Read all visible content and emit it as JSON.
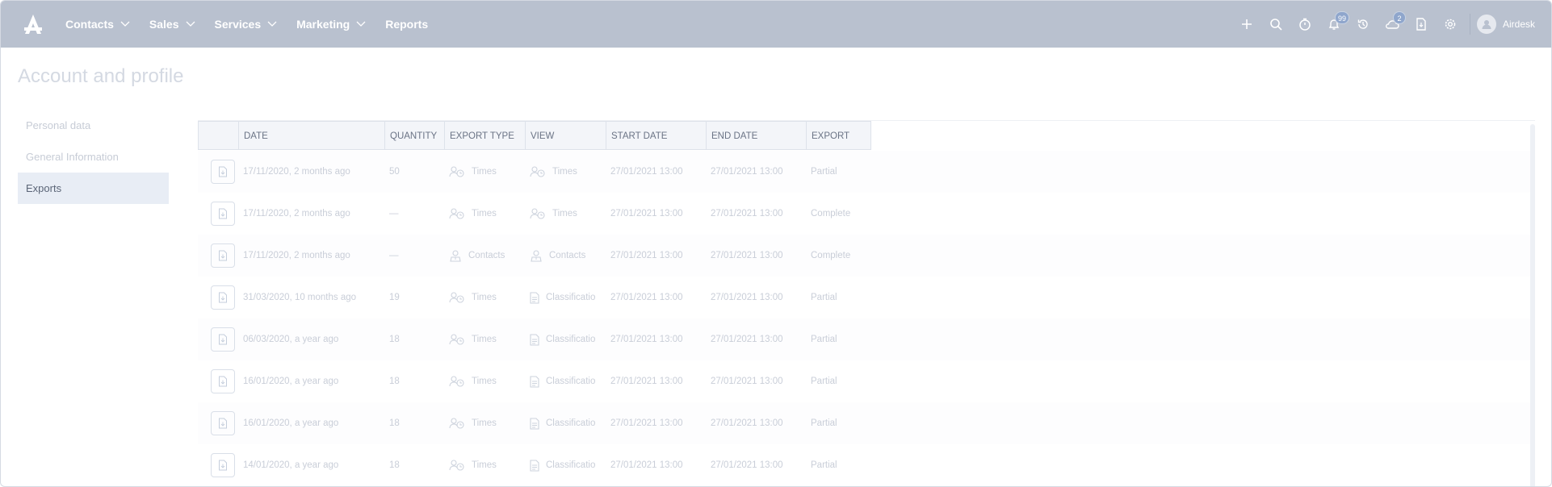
{
  "nav": {
    "items": [
      {
        "label": "Contacts",
        "has_menu": true
      },
      {
        "label": "Sales",
        "has_menu": true
      },
      {
        "label": "Services",
        "has_menu": true
      },
      {
        "label": "Marketing",
        "has_menu": true
      },
      {
        "label": "Reports",
        "has_menu": false
      }
    ],
    "notifications_count": "99",
    "cloud_count": "2",
    "user_name": "Airdesk"
  },
  "page": {
    "title": "Account and profile"
  },
  "side_menu": {
    "items": [
      {
        "label": "Personal data",
        "active": false
      },
      {
        "label": "General Information",
        "active": false
      },
      {
        "label": "Exports",
        "active": true
      }
    ]
  },
  "table": {
    "columns": [
      "",
      "DATE",
      "QUANTITY",
      "EXPORT TYPE",
      "VIEW",
      "START DATE",
      "END DATE",
      "EXPORT"
    ],
    "rows": [
      {
        "date": "17/11/2020, 2 months ago",
        "quantity": "50",
        "export_type": "Times",
        "export_type_icon": "user-clock-icon",
        "view": "Times",
        "view_icon": "user-clock-icon",
        "start": "27/01/2021 13:00",
        "end": "27/01/2021 13:00",
        "export": "Partial"
      },
      {
        "date": "17/11/2020, 2 months ago",
        "quantity": "—",
        "export_type": "Times",
        "export_type_icon": "user-clock-icon",
        "view": "Times",
        "view_icon": "user-clock-icon",
        "start": "27/01/2021 13:00",
        "end": "27/01/2021 13:00",
        "export": "Complete"
      },
      {
        "date": "17/11/2020, 2 months ago",
        "quantity": "—",
        "export_type": "Contacts",
        "export_type_icon": "contact-icon",
        "view": "Contacts",
        "view_icon": "contact-icon",
        "start": "27/01/2021 13:00",
        "end": "27/01/2021 13:00",
        "export": "Complete"
      },
      {
        "date": "31/03/2020, 10 months ago",
        "quantity": "19",
        "export_type": "Times",
        "export_type_icon": "user-clock-icon",
        "view": "Classificatio",
        "view_icon": "document-icon",
        "start": "27/01/2021 13:00",
        "end": "27/01/2021 13:00",
        "export": "Partial"
      },
      {
        "date": "06/03/2020, a year ago",
        "quantity": "18",
        "export_type": "Times",
        "export_type_icon": "user-clock-icon",
        "view": "Classificatio",
        "view_icon": "document-icon",
        "start": "27/01/2021 13:00",
        "end": "27/01/2021 13:00",
        "export": "Partial"
      },
      {
        "date": "16/01/2020, a year ago",
        "quantity": "18",
        "export_type": "Times",
        "export_type_icon": "user-clock-icon",
        "view": "Classificatio",
        "view_icon": "document-icon",
        "start": "27/01/2021 13:00",
        "end": "27/01/2021 13:00",
        "export": "Partial"
      },
      {
        "date": "16/01/2020, a year ago",
        "quantity": "18",
        "export_type": "Times",
        "export_type_icon": "user-clock-icon",
        "view": "Classificatio",
        "view_icon": "document-icon",
        "start": "27/01/2021 13:00",
        "end": "27/01/2021 13:00",
        "export": "Partial"
      },
      {
        "date": "14/01/2020, a year ago",
        "quantity": "18",
        "export_type": "Times",
        "export_type_icon": "user-clock-icon",
        "view": "Classificatio",
        "view_icon": "document-icon",
        "start": "27/01/2021 13:00",
        "end": "27/01/2021 13:00",
        "export": "Partial"
      }
    ]
  },
  "colors": {
    "topbar": "#b9c1cf",
    "active_menu": "#e8edf5",
    "badge": "#8fa6cc"
  }
}
